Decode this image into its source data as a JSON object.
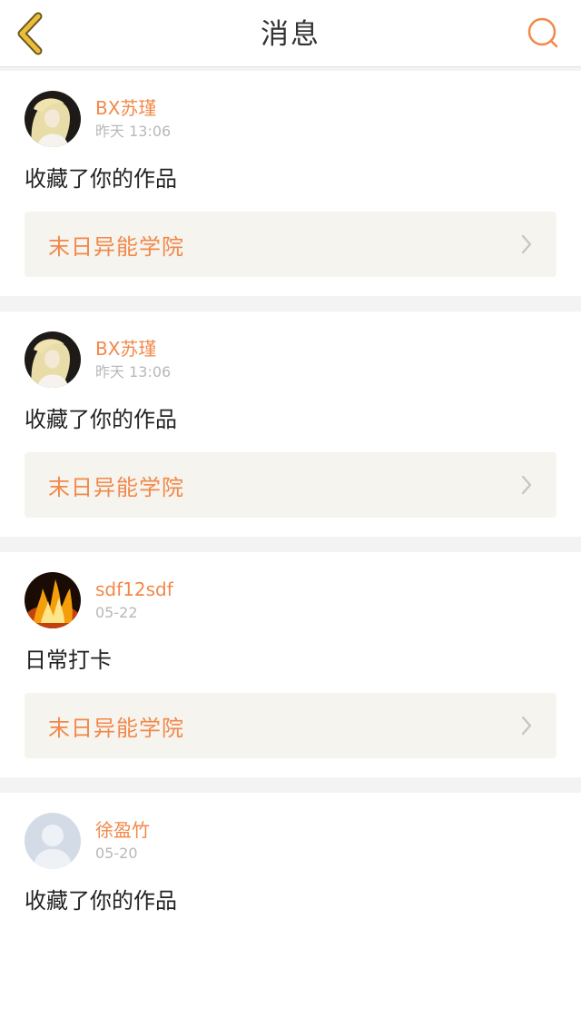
{
  "header": {
    "title": "消息",
    "back_icon": "chevron-left-icon",
    "search_icon": "search-icon"
  },
  "colors": {
    "accent": "#f2884a",
    "back_icon": "#e8b83a",
    "link_bg": "#f5f4ee"
  },
  "messages": [
    {
      "username": "BX苏瑾",
      "time": "昨天 13:06",
      "text": "收藏了你的作品",
      "work_title": "末日异能学院",
      "avatar": "blonde-portrait-avatar"
    },
    {
      "username": "BX苏瑾",
      "time": "昨天 13:06",
      "text": "收藏了你的作品",
      "work_title": "末日异能学院",
      "avatar": "blonde-portrait-avatar"
    },
    {
      "username": "sdf12sdf",
      "time": "05-22",
      "text": "日常打卡",
      "work_title": "末日异能学院",
      "avatar": "fire-avatar"
    },
    {
      "username": "徐盈竹",
      "time": "05-20",
      "text": "收藏了你的作品",
      "work_title": "",
      "avatar": "default-user-avatar"
    }
  ]
}
